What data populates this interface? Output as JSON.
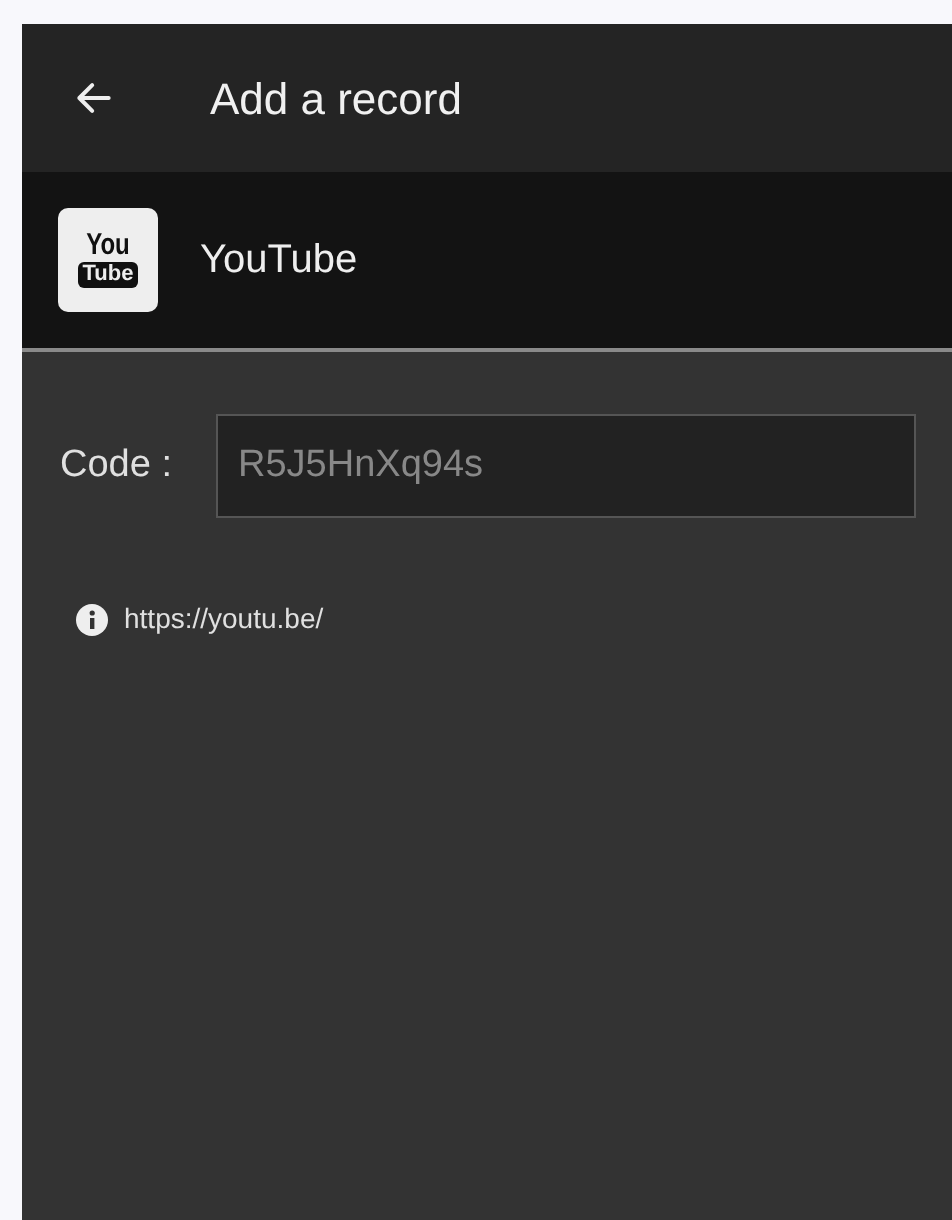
{
  "header": {
    "title": "Add a record"
  },
  "service": {
    "logo_lines": [
      "You",
      "Tube"
    ],
    "name": "YouTube"
  },
  "code_field": {
    "label": "Code :",
    "placeholder": "R5J5HnXq94s"
  },
  "info": {
    "text": "https://youtu.be/"
  }
}
